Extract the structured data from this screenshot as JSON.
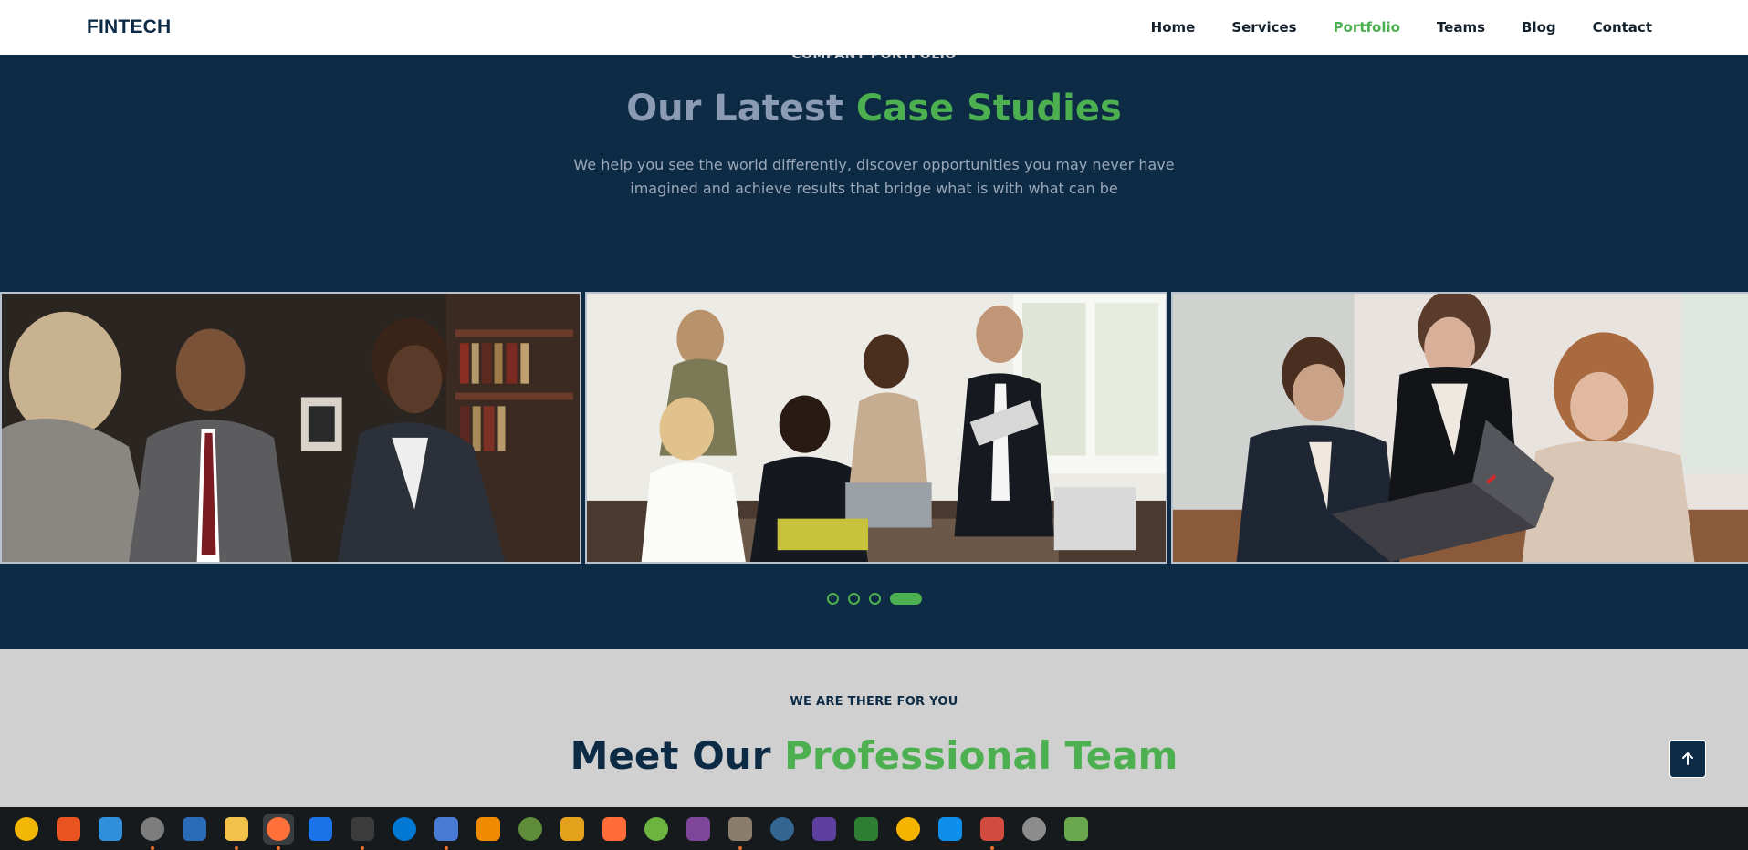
{
  "header": {
    "brand": "FINTECH",
    "nav": [
      {
        "label": "Home",
        "active": false
      },
      {
        "label": "Services",
        "active": false
      },
      {
        "label": "Portfolio",
        "active": true
      },
      {
        "label": "Teams",
        "active": false
      },
      {
        "label": "Blog",
        "active": false
      },
      {
        "label": "Contact",
        "active": false
      }
    ]
  },
  "portfolio": {
    "eyebrow": "COMPANY PORTFOLIO",
    "heading_muted": "Our Latest",
    "heading_accent": "Case Studies",
    "lead_line1": "We help you see the world differently, discover opportunities you may never have",
    "lead_line2": "imagined and achieve results that bridge what is with what can be",
    "slides": [
      {
        "icon": "business-meeting-photo"
      },
      {
        "icon": "team-discussion-photo"
      },
      {
        "icon": "laptop-collaboration-photo"
      }
    ],
    "pagination": {
      "count": 4,
      "active_index": 3
    }
  },
  "team": {
    "eyebrow": "WE ARE THERE FOR YOU",
    "heading_dark": "Meet Our",
    "heading_accent": "Professional Team"
  },
  "colors": {
    "navy": "#0d2b45",
    "accent_green": "#4cb050",
    "muted_blue": "#8a9bb3",
    "team_bg": "#d0d0d0"
  },
  "taskbar": {
    "apps": [
      {
        "name": "rhythmbox-icon",
        "color": "#f2b705",
        "indicator": false
      },
      {
        "name": "software-center-icon",
        "color": "#e95420",
        "indicator": false
      },
      {
        "name": "help-icon",
        "color": "#2f8fdd",
        "indicator": false
      },
      {
        "name": "files-icon",
        "color": "#7d7d7d",
        "indicator": true
      },
      {
        "name": "document-viewer-icon",
        "color": "#2a6bb5",
        "indicator": false
      },
      {
        "name": "text-editor-icon",
        "color": "#f0c14b",
        "indicator": true
      },
      {
        "name": "firefox-icon",
        "color": "#ff7139",
        "indicator": true
      },
      {
        "name": "wireshark-icon",
        "color": "#1a73e8",
        "indicator": false
      },
      {
        "name": "terminal-icon",
        "color": "#3b3b3b",
        "indicator": true
      },
      {
        "name": "vscode-icon",
        "color": "#0078d4",
        "indicator": false
      },
      {
        "name": "notes-icon",
        "color": "#4a7bd4",
        "indicator": true
      },
      {
        "name": "vlc-icon",
        "color": "#f08a00",
        "indicator": false
      },
      {
        "name": "network-tool-icon",
        "color": "#5e8c3a",
        "indicator": false
      },
      {
        "name": "calculator-icon",
        "color": "#e4a11b",
        "indicator": false
      },
      {
        "name": "postman-icon",
        "color": "#ff6c37",
        "indicator": false
      },
      {
        "name": "spring-tool-icon",
        "color": "#6db33f",
        "indicator": false
      },
      {
        "name": "tor-browser-icon",
        "color": "#7d4698",
        "indicator": false
      },
      {
        "name": "gimp-icon",
        "color": "#8b7d6b",
        "indicator": true
      },
      {
        "name": "postgresql-icon",
        "color": "#336791",
        "indicator": false
      },
      {
        "name": "kodi-icon",
        "color": "#5d3fa0",
        "indicator": false
      },
      {
        "name": "color-picker-icon",
        "color": "#2e7d32",
        "indicator": false
      },
      {
        "name": "sticky-notes-icon",
        "color": "#f5b400",
        "indicator": false
      },
      {
        "name": "teamviewer-icon",
        "color": "#0e8ee9",
        "indicator": false
      },
      {
        "name": "presentation-icon",
        "color": "#d14b3f",
        "indicator": true
      },
      {
        "name": "ssd-drive-icon",
        "color": "#8c8c8c",
        "indicator": false
      },
      {
        "name": "trash-icon",
        "color": "#6aa84f",
        "indicator": false
      }
    ]
  }
}
